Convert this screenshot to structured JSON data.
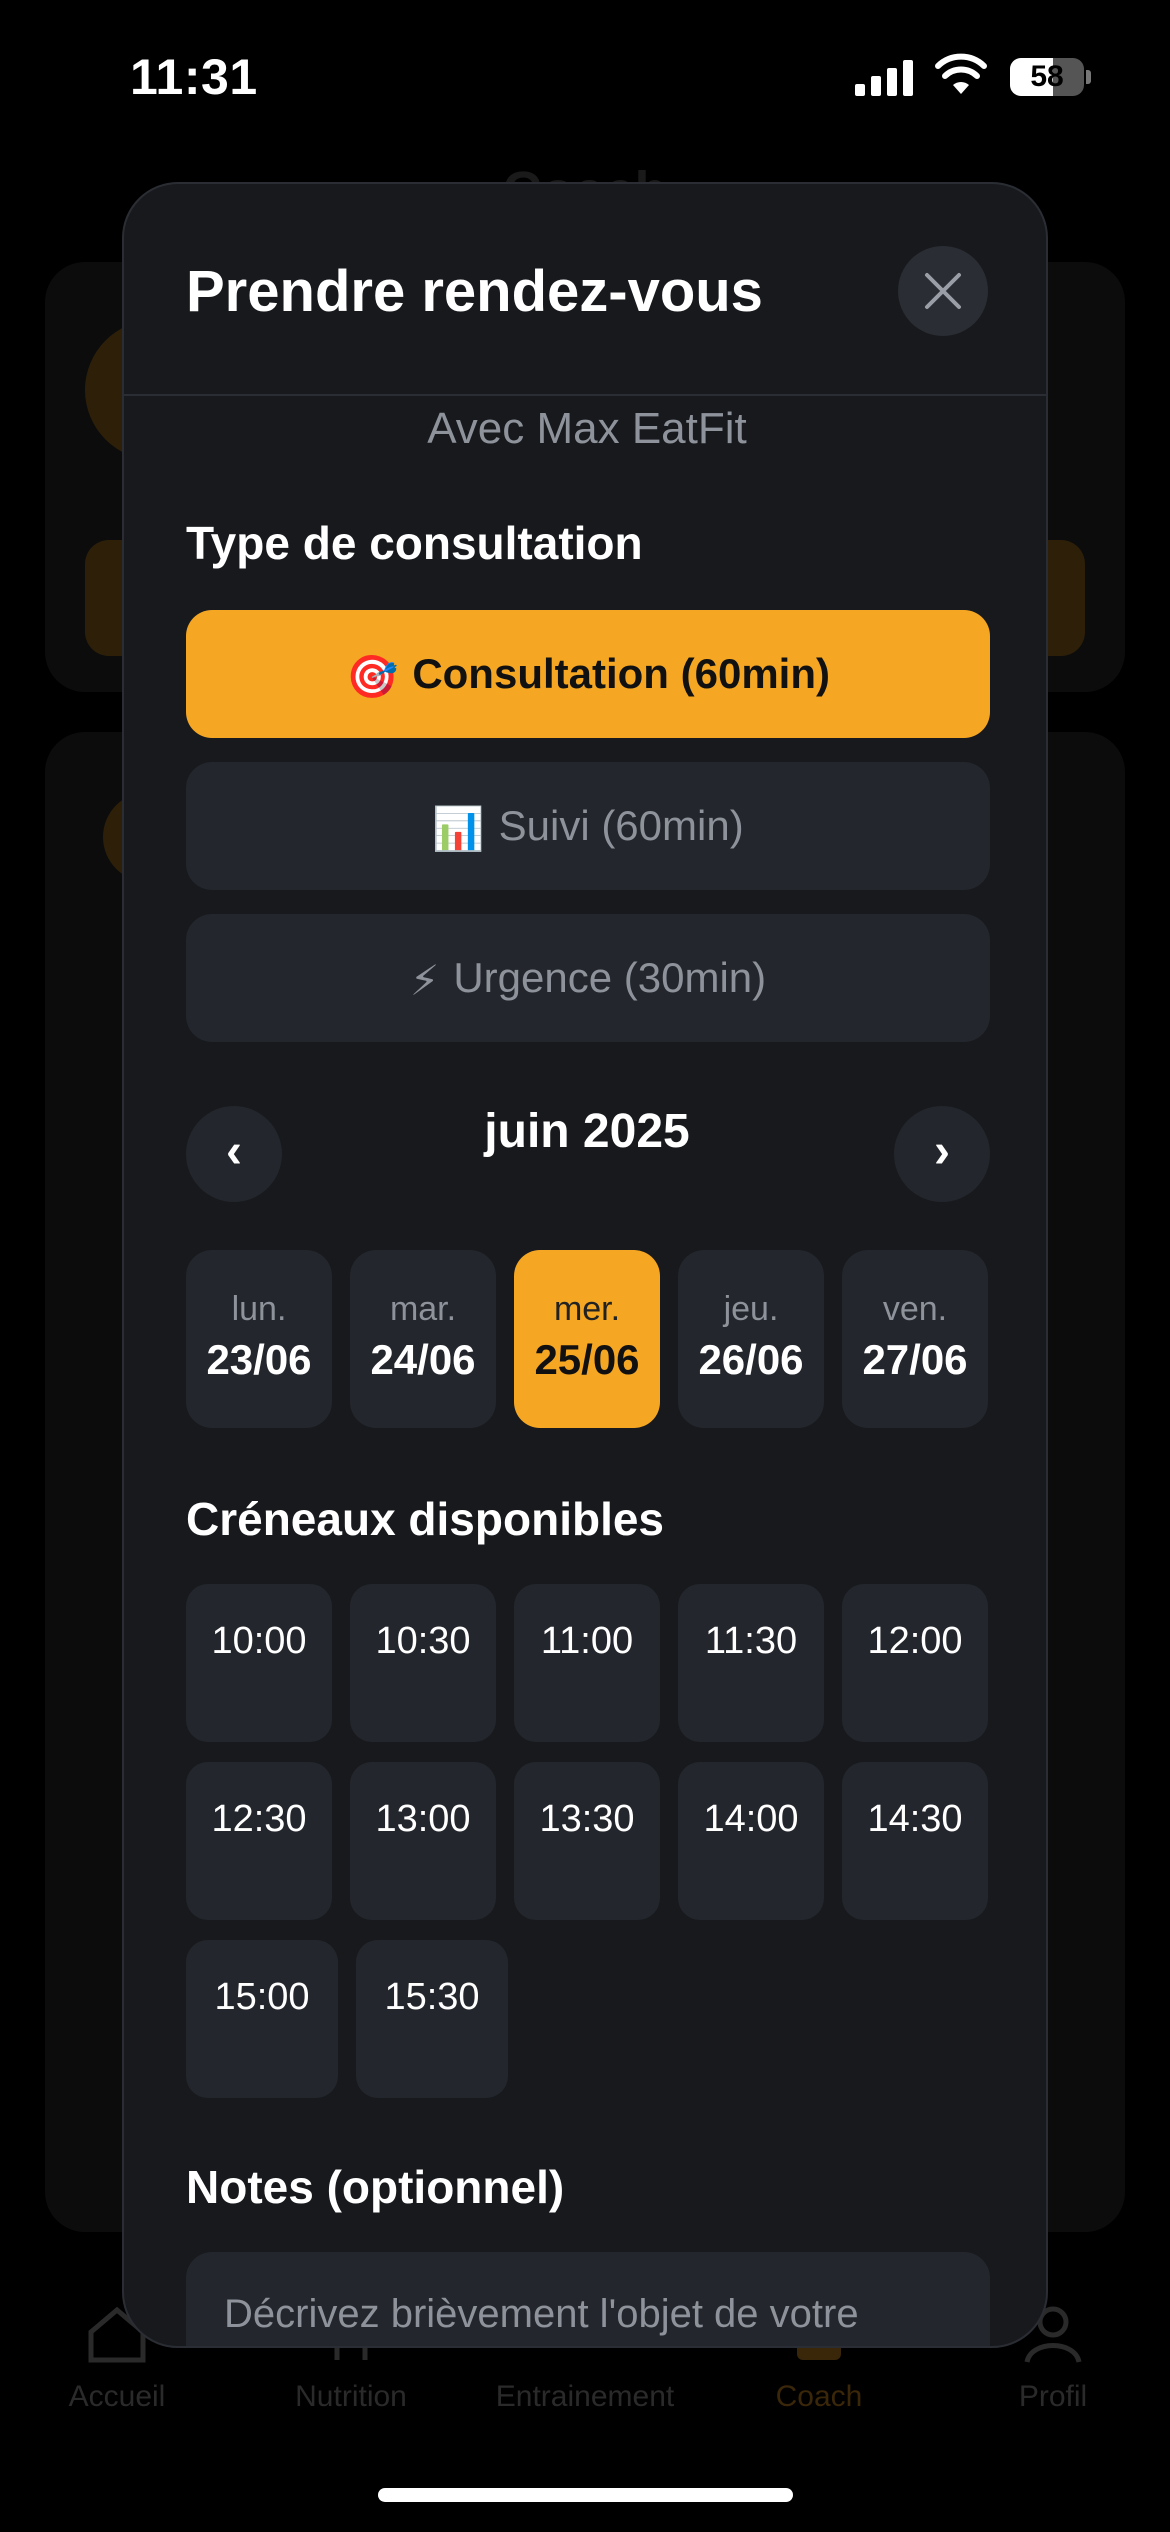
{
  "status_bar": {
    "time": "11:31",
    "battery": "58",
    "battery_level": 0.58
  },
  "background": {
    "header_title": "Coach",
    "tabs": [
      {
        "label": "Accueil",
        "icon": "home-icon",
        "active": false
      },
      {
        "label": "Nutrition",
        "icon": "nutrition-icon",
        "active": false
      },
      {
        "label": "Entrainement",
        "icon": "dumbbell-icon",
        "active": false
      },
      {
        "label": "Coach",
        "icon": "coach-icon",
        "active": true
      },
      {
        "label": "Profil",
        "icon": "profile-icon",
        "active": false
      }
    ]
  },
  "modal": {
    "title": "Prendre rendez-vous",
    "close_icon": "close-icon",
    "subtitle": "Avec Max EatFit",
    "type_section_title": "Type de consultation",
    "types": [
      {
        "emoji": "🎯",
        "label": "Consultation (60min)",
        "selected": true
      },
      {
        "emoji": "📊",
        "label": "Suivi (60min)",
        "selected": false
      },
      {
        "emoji": "⚡",
        "label": "Urgence (30min)",
        "selected": false
      }
    ],
    "calendar": {
      "month_label": "juin 2025",
      "prev_label": "‹",
      "next_label": "›",
      "days": [
        {
          "name": "lun.",
          "date": "23/06",
          "selected": false
        },
        {
          "name": "mar.",
          "date": "24/06",
          "selected": false
        },
        {
          "name": "mer.",
          "date": "25/06",
          "selected": true
        },
        {
          "name": "jeu.",
          "date": "26/06",
          "selected": false
        },
        {
          "name": "ven.",
          "date": "27/06",
          "selected": false
        }
      ]
    },
    "slots_title": "Créneaux disponibles",
    "slots": [
      "10:00",
      "10:30",
      "11:00",
      "11:30",
      "12:00",
      "12:30",
      "13:00",
      "13:30",
      "14:00",
      "14:30",
      "15:00",
      "15:30"
    ],
    "notes_title": "Notes (optionnel)",
    "notes_placeholder": "Décrivez brièvement l'objet de votre"
  },
  "colors": {
    "accent": "#f5a623",
    "modal_bg": "#17191d",
    "chip_bg": "#23262c",
    "muted_text": "#8e929a"
  }
}
